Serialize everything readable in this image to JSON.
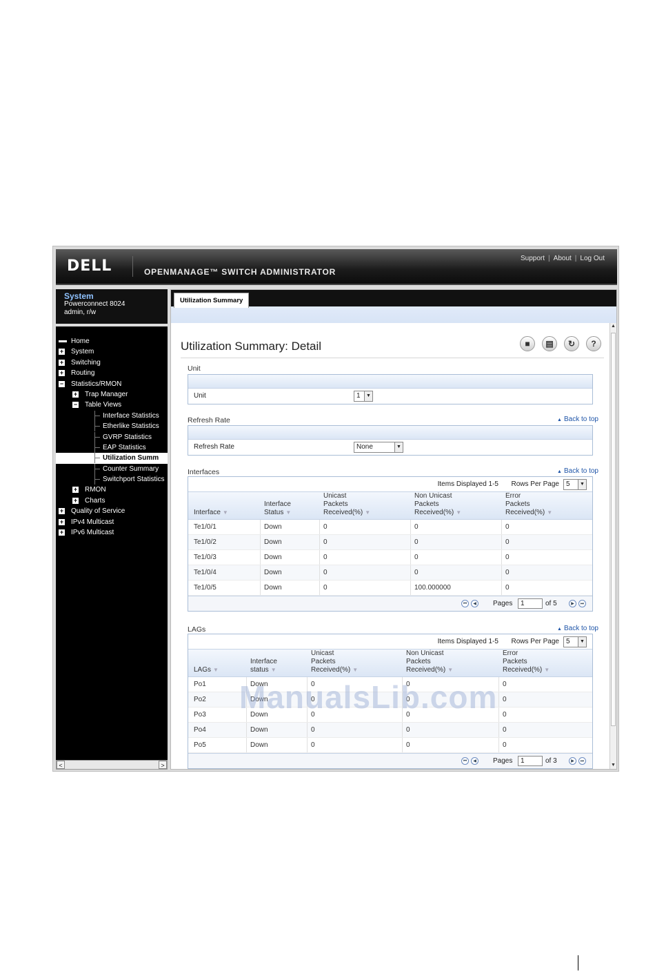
{
  "header": {
    "logo": "DELL",
    "product": "OPENMANAGE™ SWITCH ADMINISTRATOR",
    "links": [
      "Support",
      "About",
      "Log Out"
    ]
  },
  "system": {
    "title": "System",
    "model": "Powerconnect 8024",
    "user": "admin, r/w"
  },
  "nav": [
    {
      "label": "Home",
      "level": 0,
      "icon": "home-icon"
    },
    {
      "label": "System",
      "level": 0,
      "icon": "expand-icon"
    },
    {
      "label": "Switching",
      "level": 0,
      "icon": "expand-icon"
    },
    {
      "label": "Routing",
      "level": 0,
      "icon": "expand-icon"
    },
    {
      "label": "Statistics/RMON",
      "level": 0,
      "icon": "collapse-icon"
    },
    {
      "label": "Trap Manager",
      "level": 1,
      "icon": "expand-icon"
    },
    {
      "label": "Table Views",
      "level": 1,
      "icon": "collapse-icon"
    },
    {
      "label": "Interface Statistics",
      "level": 2,
      "icon": ""
    },
    {
      "label": "Etherlike Statistics",
      "level": 2,
      "icon": ""
    },
    {
      "label": "GVRP Statistics",
      "level": 2,
      "icon": ""
    },
    {
      "label": "EAP Statistics",
      "level": 2,
      "icon": ""
    },
    {
      "label": "Utilization Summ",
      "level": 2,
      "icon": "",
      "selected": true
    },
    {
      "label": "Counter Summary",
      "level": 2,
      "icon": ""
    },
    {
      "label": "Switchport Statistics",
      "level": 2,
      "icon": ""
    },
    {
      "label": "RMON",
      "level": 1,
      "icon": "expand-icon"
    },
    {
      "label": "Charts",
      "level": 1,
      "icon": "expand-icon"
    },
    {
      "label": "Quality of Service",
      "level": 0,
      "icon": "expand-icon"
    },
    {
      "label": "IPv4 Multicast",
      "level": 0,
      "icon": "expand-icon"
    },
    {
      "label": "IPv6 Multicast",
      "level": 0,
      "icon": "expand-icon"
    }
  ],
  "tab": "Utilization Summary",
  "page_title": "Utilization Summary: Detail",
  "tools": [
    "save-icon",
    "print-icon",
    "refresh-icon",
    "help-icon"
  ],
  "back_to_top": "Back to top",
  "unit": {
    "section": "Unit",
    "label": "Unit",
    "value": "1"
  },
  "refresh": {
    "section": "Refresh Rate",
    "label": "Refresh Rate",
    "value": "None"
  },
  "watermark": "ManualsLib.com",
  "interfaces": {
    "section": "Interfaces",
    "items_displayed": "Items Displayed 1-5",
    "rows_per_page_label": "Rows Per Page",
    "rows_per_page": "5",
    "columns": [
      "Interface",
      "Interface\nStatus",
      "Unicast\nPackets\nReceived(%)",
      "Non Unicast\nPackets\nReceived(%)",
      "Error\nPackets\nReceived(%)"
    ],
    "rows": [
      [
        "Te1/0/1",
        "Down",
        "0",
        "0",
        "0"
      ],
      [
        "Te1/0/2",
        "Down",
        "0",
        "0",
        "0"
      ],
      [
        "Te1/0/3",
        "Down",
        "0",
        "0",
        "0"
      ],
      [
        "Te1/0/4",
        "Down",
        "0",
        "0",
        "0"
      ],
      [
        "Te1/0/5",
        "Down",
        "0",
        "100.000000",
        "0"
      ]
    ],
    "pages_label": "Pages",
    "page": "1",
    "of": "of 5"
  },
  "lags": {
    "section": "LAGs",
    "items_displayed": "Items Displayed 1-5",
    "rows_per_page_label": "Rows Per Page",
    "rows_per_page": "5",
    "columns": [
      "LAGs",
      "Interface\nstatus",
      "Unicast\nPackets\nReceived(%)",
      "Non Unicast\nPackets\nReceived(%)",
      "Error\nPackets\nReceived(%)"
    ],
    "rows": [
      [
        "Po1",
        "Down",
        "0",
        "0",
        "0"
      ],
      [
        "Po2",
        "Down",
        "0",
        "0",
        "0"
      ],
      [
        "Po3",
        "Down",
        "0",
        "0",
        "0"
      ],
      [
        "Po4",
        "Down",
        "0",
        "0",
        "0"
      ],
      [
        "Po5",
        "Down",
        "0",
        "0",
        "0"
      ]
    ],
    "pages_label": "Pages",
    "page": "1",
    "of": "of 3"
  }
}
